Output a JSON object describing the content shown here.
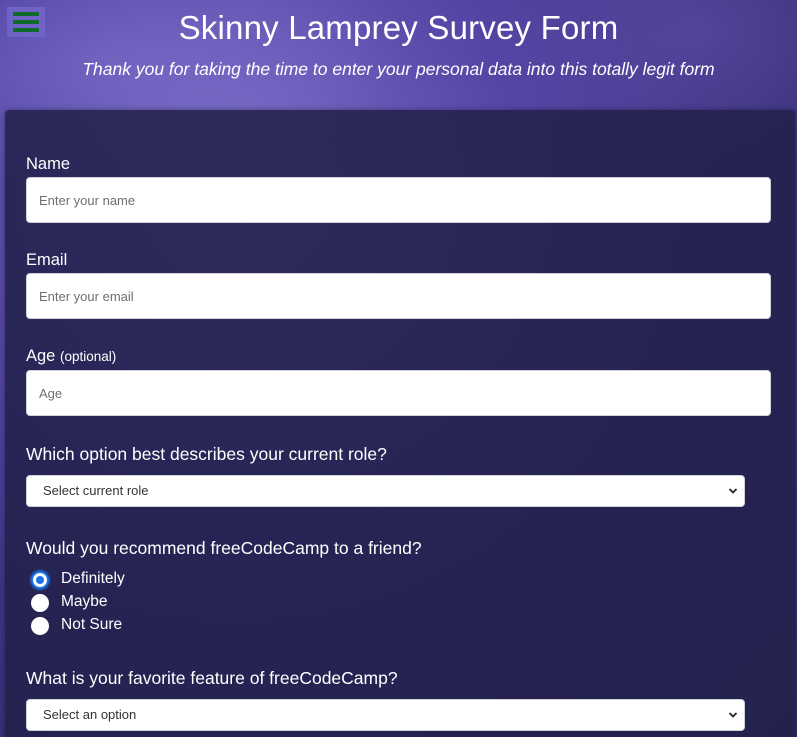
{
  "header": {
    "title": "Skinny Lamprey Survey Form",
    "subtitle": "Thank you for taking the time to enter your personal data into this totally legit form"
  },
  "menu": {
    "icon": "hamburger-menu-icon",
    "icon_color": "#0f6b2c"
  },
  "form": {
    "name": {
      "label": "Name",
      "placeholder": "Enter your name",
      "value": ""
    },
    "email": {
      "label": "Email",
      "placeholder": "Enter your email",
      "value": ""
    },
    "age": {
      "label": "Age",
      "label_suffix": "(optional)",
      "placeholder": "Age",
      "value": ""
    },
    "role": {
      "question": "Which option best describes your current role?",
      "selected": "Select current role"
    },
    "recommend": {
      "question": "Would you recommend freeCodeCamp to a friend?",
      "options": [
        {
          "label": "Definitely",
          "checked": true
        },
        {
          "label": "Maybe",
          "checked": false
        },
        {
          "label": "Not Sure",
          "checked": false
        }
      ]
    },
    "favorite_feature": {
      "question": "What is your favorite feature of freeCodeCamp?",
      "selected": "Select an option"
    }
  },
  "colors": {
    "accent_radio": "#1a73e8",
    "card_background": "#22214a",
    "menu_button_bg": "#6f63c5"
  }
}
